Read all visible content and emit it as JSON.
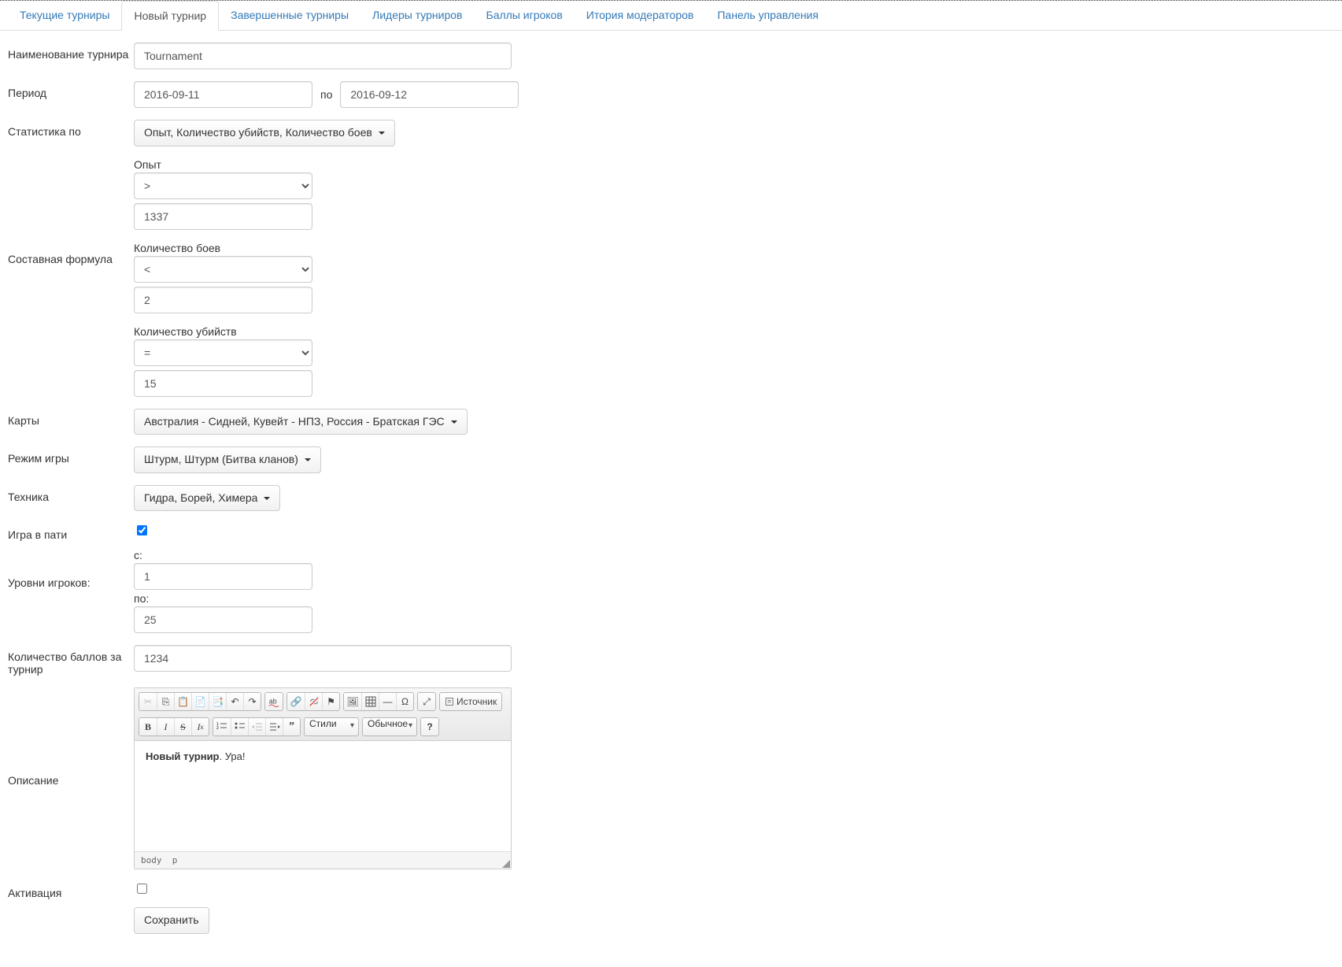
{
  "tabs": [
    {
      "label": "Текущие турниры"
    },
    {
      "label": "Новый турнир"
    },
    {
      "label": "Завершенные турниры"
    },
    {
      "label": "Лидеры турниров"
    },
    {
      "label": "Баллы игроков"
    },
    {
      "label": "Итория модераторов"
    },
    {
      "label": "Панель управления"
    }
  ],
  "labels": {
    "name": "Наименование турнира",
    "period": "Период",
    "period_sep": "по",
    "stats_by": "Статистика по",
    "formula": "Составная формула",
    "maps": "Карты",
    "mode": "Режим игры",
    "tech": "Техника",
    "party": "Игра в пати",
    "levels": "Уровни игроков:",
    "level_from": "с:",
    "level_to": "по:",
    "points": "Количество баллов за турнир",
    "description": "Описание",
    "activation": "Активация"
  },
  "values": {
    "name": "Tournament",
    "date_from": "2016-09-11",
    "date_to": "2016-09-12",
    "stats_dropdown": "Опыт, Количество убийств, Количество боев",
    "maps_dropdown": "Австралия - Сидней, Кувейт - НПЗ, Россия - Братская ГЭС",
    "mode_dropdown": "Штурм, Штурм (Битва кланов)",
    "tech_dropdown": "Гидра, Борей, Химера",
    "level_from": "1",
    "level_to": "25",
    "points": "1234"
  },
  "formula": [
    {
      "label": "Опыт",
      "op": ">",
      "val": "1337"
    },
    {
      "label": "Количество боев",
      "op": "<",
      "val": "2"
    },
    {
      "label": "Количество убийств",
      "op": "=",
      "val": "15"
    }
  ],
  "editor": {
    "styles_label": "Стили",
    "format_label": "Обычное",
    "source_label": "Источник",
    "bold": "Новый турнир",
    "text": ". Ура!",
    "path": "body  p"
  },
  "save_label": "Сохранить"
}
